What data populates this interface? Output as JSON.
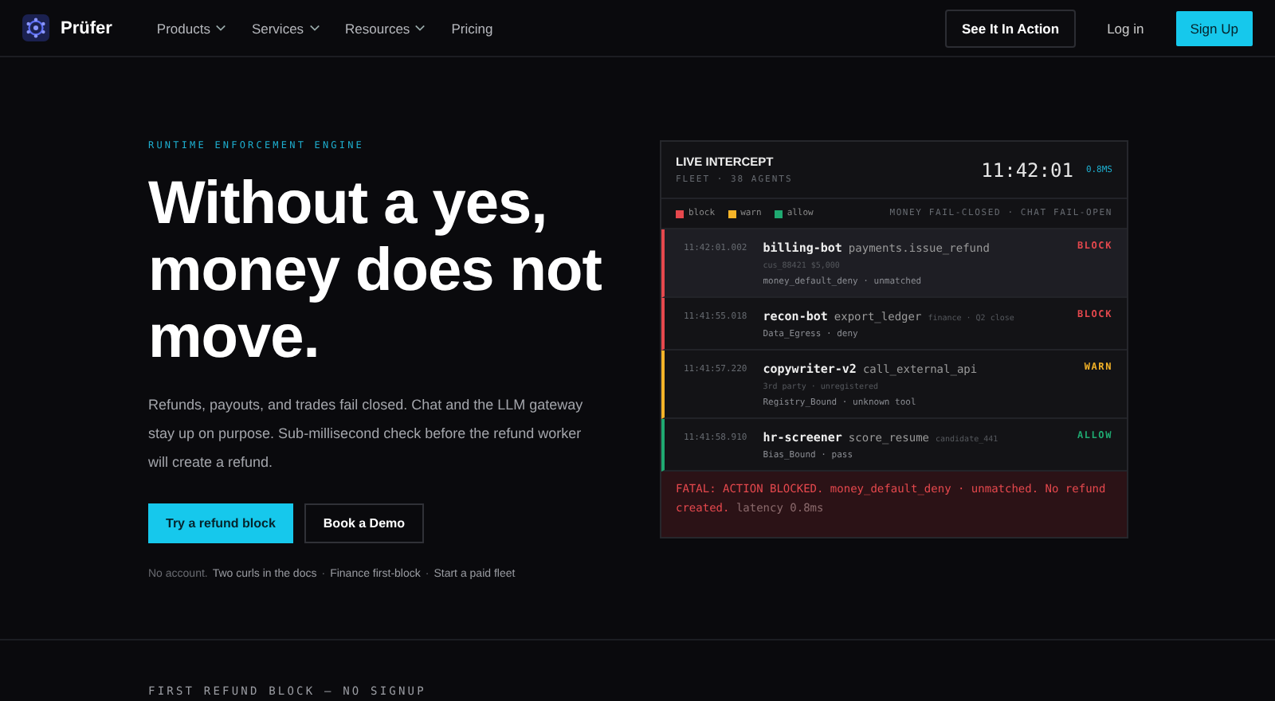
{
  "nav": {
    "brand": "Prüfer",
    "items": [
      {
        "label": "Products",
        "dropdown": true
      },
      {
        "label": "Services",
        "dropdown": true
      },
      {
        "label": "Resources",
        "dropdown": true
      },
      {
        "label": "Pricing",
        "dropdown": false
      }
    ],
    "demo": "See It In Action",
    "login": "Log in",
    "signup": "Sign Up"
  },
  "hero": {
    "eyebrow": "RUNTIME ENFORCEMENT ENGINE",
    "headline": [
      "Without a yes,",
      "money does not",
      "move."
    ],
    "body": "Refunds, payouts, and trades fail closed. Chat and the LLM gateway stay up on purpose. Sub-millisecond check before the refund worker will create a refund.",
    "primary": "Try a refund block",
    "secondary": "Book a Demo",
    "footnote": {
      "prefix": "No account.",
      "separator": "·",
      "links": [
        "Two curls in the docs",
        "Finance first-block",
        "Start a paid fleet"
      ]
    }
  },
  "panel": {
    "title": "LIVE INTERCEPT",
    "subtitle": "FLEET · 38 AGENTS",
    "clock": "11:42:01",
    "latency": "0.8MS",
    "legend": [
      {
        "label": "block",
        "color": "#e5484d"
      },
      {
        "label": "warn",
        "color": "#f5b428"
      },
      {
        "label": "allow",
        "color": "#1fa971"
      }
    ],
    "mode": "MONEY FAIL-CLOSED · CHAT FAIL-OPEN",
    "events": [
      {
        "time": "11:42:01.002",
        "agent": "billing-bot",
        "action": "payments.issue_refund",
        "meta": "cus_88421 $5,000",
        "detail": "money_default_deny · unmatched",
        "verdict": "BLOCK",
        "kind": "block",
        "meta_inline": false,
        "selected": true
      },
      {
        "time": "11:41:55.018",
        "agent": "recon-bot",
        "action": "export_ledger",
        "meta": "finance · Q2 close",
        "detail": "Data_Egress · deny",
        "verdict": "BLOCK",
        "kind": "block",
        "meta_inline": true,
        "selected": false
      },
      {
        "time": "11:41:57.220",
        "agent": "copywriter-v2",
        "action": "call_external_api",
        "meta": "3rd party · unregistered",
        "detail": "Registry_Bound · unknown tool",
        "verdict": "WARN",
        "kind": "warn",
        "meta_inline": false,
        "selected": false
      },
      {
        "time": "11:41:58.910",
        "agent": "hr-screener",
        "action": "score_resume",
        "meta": "candidate_441",
        "detail": "Bias_Bound · pass",
        "verdict": "ALLOW",
        "kind": "allow",
        "meta_inline": true,
        "selected": false
      }
    ],
    "fatal": {
      "message": "FATAL: ACTION BLOCKED. money_default_deny · unmatched. No refund created.",
      "latency": "latency 0.8ms"
    }
  },
  "next_section": {
    "eyebrow": "FIRST REFUND BLOCK — NO SIGNUP"
  }
}
